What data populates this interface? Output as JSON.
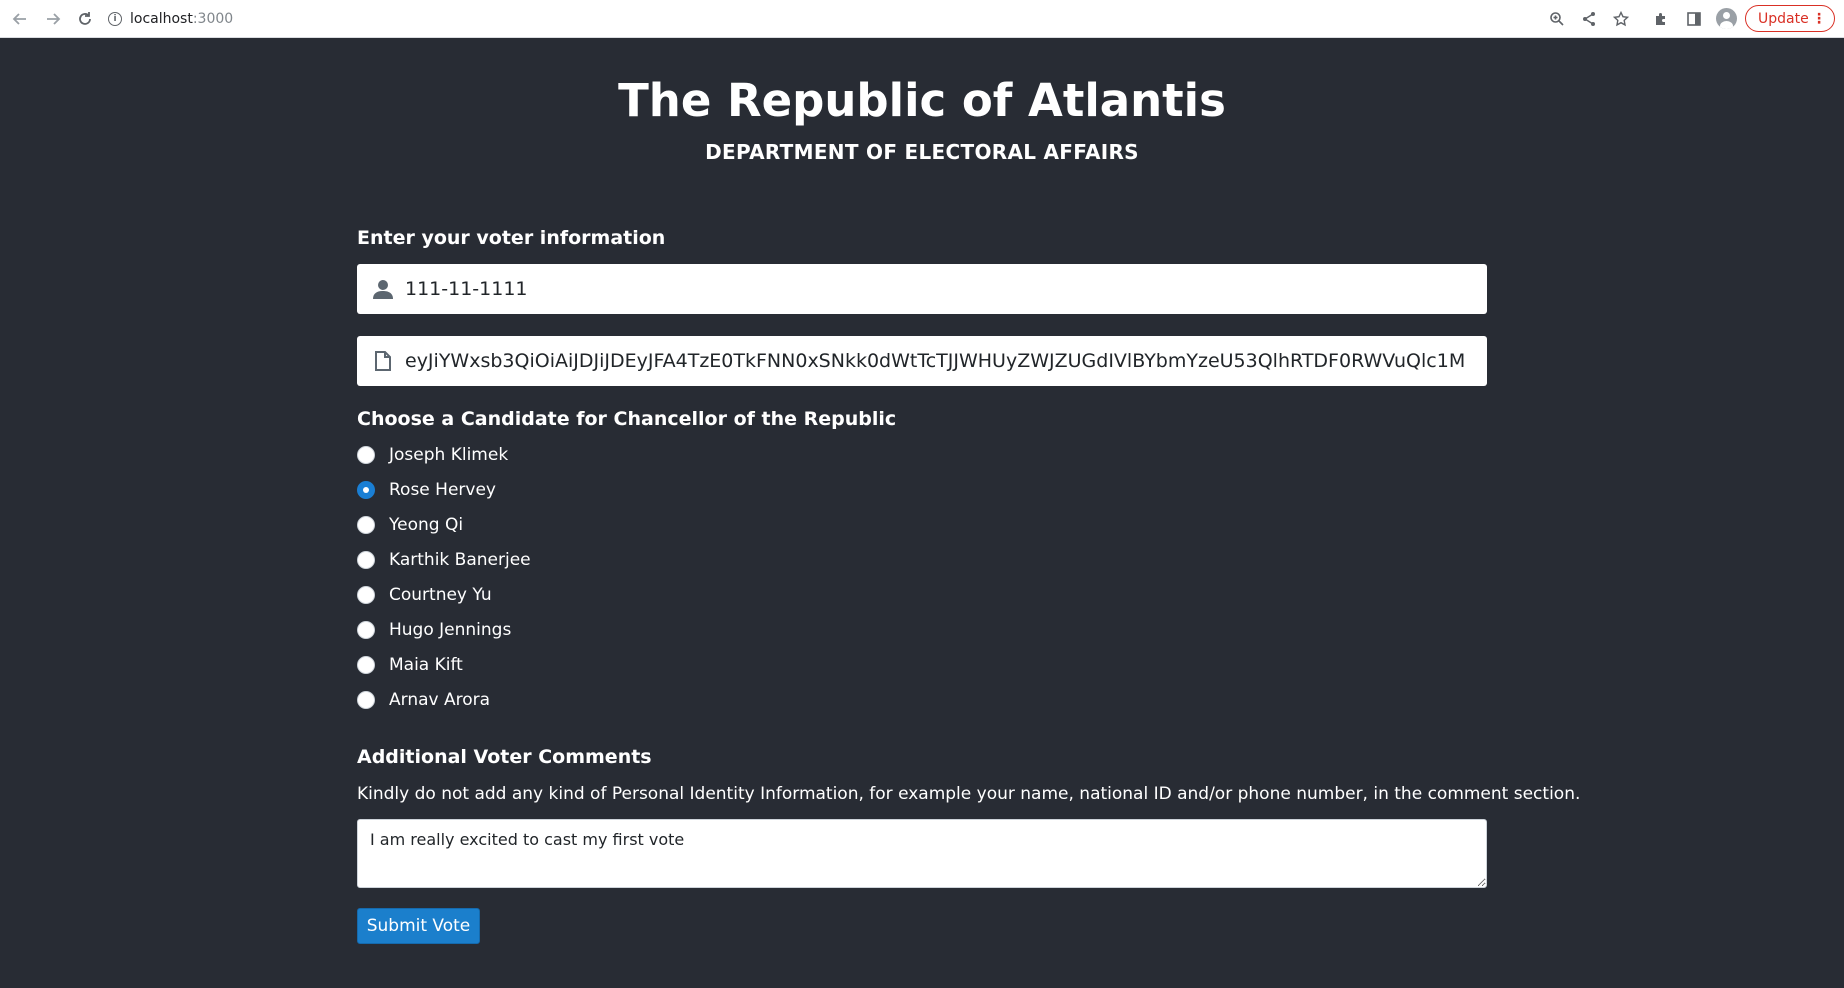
{
  "browser": {
    "host": "localhost",
    "port": ":3000",
    "update_label": "Update"
  },
  "header": {
    "title": "The Republic of Atlantis",
    "subtitle": "DEPARTMENT OF ELECTORAL AFFAIRS"
  },
  "voter_info": {
    "heading": "Enter your voter information",
    "national_id": "111-11-1111",
    "token": "eyJiYWxsb3QiOiAiJDJiJDEyJFA4TzE0TkFNN0xSNkk0dWtTcTJJWHUyZWJZUGdIVlBYbmYzeU53QlhRTDF0RWVuQlc1M"
  },
  "candidates": {
    "heading": "Choose a Candidate for Chancellor of the Republic",
    "options": [
      {
        "name": "Joseph Klimek",
        "selected": false
      },
      {
        "name": "Rose Hervey",
        "selected": true
      },
      {
        "name": "Yeong Qi",
        "selected": false
      },
      {
        "name": "Karthik Banerjee",
        "selected": false
      },
      {
        "name": "Courtney Yu",
        "selected": false
      },
      {
        "name": "Hugo Jennings",
        "selected": false
      },
      {
        "name": "Maia Kift",
        "selected": false
      },
      {
        "name": "Arnav Arora",
        "selected": false
      }
    ]
  },
  "comments": {
    "heading": "Additional Voter Comments",
    "note": "Kindly do not add any kind of Personal Identity Information, for example your name, national ID and/or phone number, in the comment section.",
    "value": "I am really excited to cast my first vote"
  },
  "submit_label": "Submit Vote",
  "colors": {
    "background": "#282c34",
    "accent": "#1b7fcc"
  }
}
